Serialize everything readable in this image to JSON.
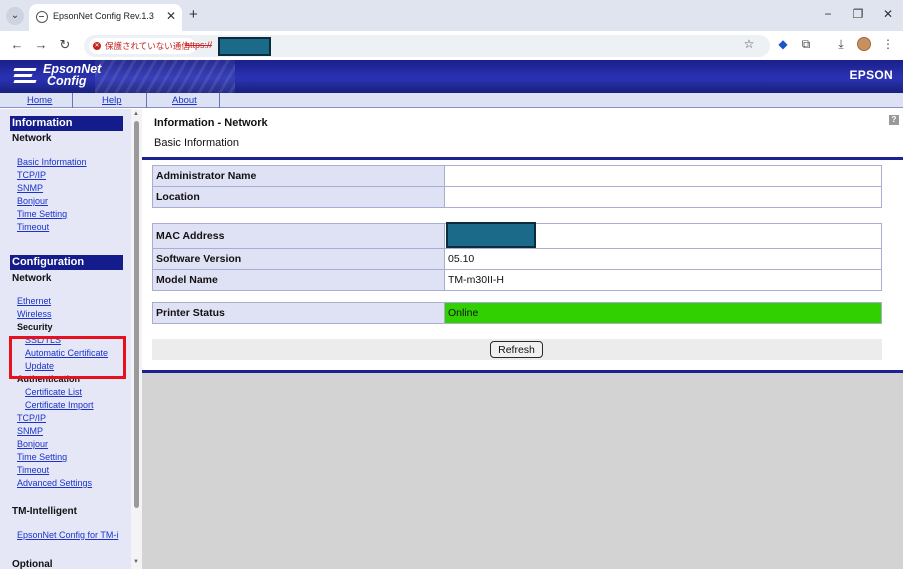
{
  "browser": {
    "tab_title": "EpsonNet Config Rev.1.3",
    "tab_close": "✕",
    "new_tab": "+",
    "tab_menu": "⌄",
    "controls": {
      "minimize": "−",
      "restore": "❐",
      "close": "✕"
    },
    "nav": {
      "back": "←",
      "forward": "→",
      "reload": "↻"
    },
    "security_label": "保護されていない通信",
    "url_scheme": "https://",
    "toolbar_icons": {
      "bookmark": "☆",
      "extension_shield": "◆",
      "extensions": "⧉",
      "download": "⤓",
      "menu": "⋮"
    }
  },
  "banner": {
    "logo_line1": "EpsonNet",
    "logo_line2": "Config",
    "brand": "EPSON"
  },
  "topnav": {
    "home": "Home",
    "help": "Help",
    "about": "About"
  },
  "menu": {
    "information": {
      "heading": "Information",
      "network_label": "Network",
      "items": [
        "Basic Information",
        "TCP/IP",
        "SNMP",
        "Bonjour",
        "Time Setting",
        "Timeout"
      ]
    },
    "configuration": {
      "heading": "Configuration",
      "network_label": "Network",
      "ethernet": "Ethernet",
      "wireless": "Wireless",
      "security_label": "Security",
      "ssl_tls": "SSL/TLS",
      "automatic_certificate": "Automatic Certificate",
      "update": "Update",
      "authentication_label": "Authentication",
      "certificate_list": "Certificate List",
      "certificate_import": "Certificate Import",
      "tcpip": "TCP/IP",
      "snmp": "SNMP",
      "bonjour": "Bonjour",
      "time_setting": "Time Setting",
      "timeout": "Timeout",
      "advanced_settings": "Advanced Settings"
    },
    "tm_intelligent": {
      "heading": "TM-Intelligent",
      "link": "EpsonNet Config for TM-i"
    },
    "optional": {
      "heading": "Optional"
    }
  },
  "main": {
    "title": "Information - Network",
    "subtitle": "Basic Information",
    "help_icon": "?",
    "table1": [
      {
        "label": "Administrator Name",
        "value": ""
      },
      {
        "label": "Location",
        "value": ""
      }
    ],
    "table2": [
      {
        "label": "MAC Address",
        "value": ""
      },
      {
        "label": "Software Version",
        "value": "05.10"
      },
      {
        "label": "Model Name",
        "value": "TM-m30II-H"
      }
    ],
    "status": {
      "label": "Printer Status",
      "value": "Online",
      "color": "#31d000"
    },
    "refresh_label": "Refresh"
  },
  "colors": {
    "banner": "#1d2291",
    "menu_heading": "#131c8a",
    "link": "#1a33cc",
    "highlight": "#e8101c"
  }
}
